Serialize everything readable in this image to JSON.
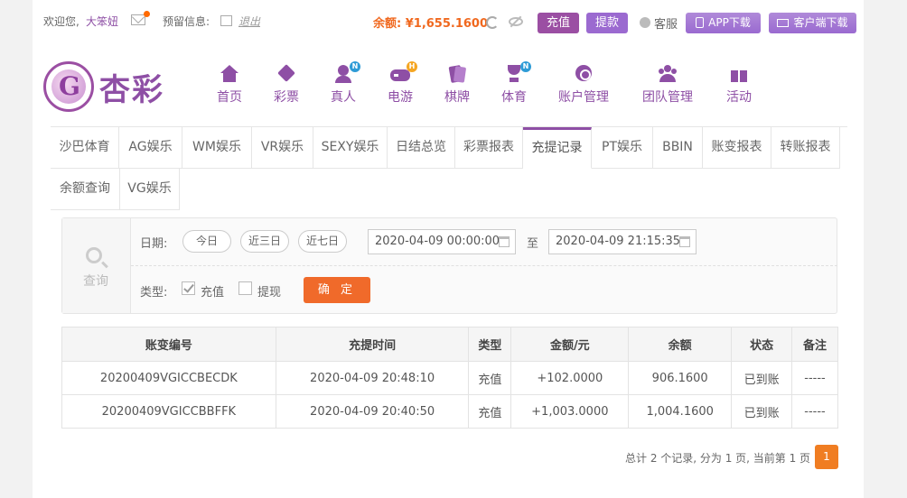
{
  "header": {
    "welcome": "欢迎您,",
    "username": "大笨妞",
    "reserved_info": "预留信息:",
    "logout": "退出",
    "balance": "余额: ¥1,655.1600",
    "recharge": "充值",
    "withdraw": "提款",
    "service": "客服",
    "app_download": "APP下载",
    "client_download": "客户端下载"
  },
  "brand": {
    "logo_text": "杏彩"
  },
  "nav": [
    {
      "label": "首页",
      "icon": "home-icon"
    },
    {
      "label": "彩票",
      "icon": "ticket-icon"
    },
    {
      "label": "真人",
      "icon": "person-icon",
      "badge": "N"
    },
    {
      "label": "电游",
      "icon": "gamepad-icon",
      "badge": "H"
    },
    {
      "label": "棋牌",
      "icon": "cards-icon"
    },
    {
      "label": "体育",
      "icon": "trophy-icon",
      "badge": "N"
    },
    {
      "label": "账户管理",
      "icon": "coin-icon"
    },
    {
      "label": "团队管理",
      "icon": "team-icon"
    },
    {
      "label": "活动",
      "icon": "gift-icon"
    }
  ],
  "tabs": [
    "沙巴体育",
    "AG娱乐",
    "WM娱乐",
    "VR娱乐",
    "SEXY娱乐",
    "日结总览",
    "彩票报表",
    "充提记录",
    "PT娱乐",
    "BBIN",
    "账变报表",
    "转账报表",
    "余额查询",
    "VG娱乐"
  ],
  "active_tab": "充提记录",
  "search": {
    "side_label": "查询",
    "date_label": "日期:",
    "quick": [
      "今日",
      "近三日",
      "近七日"
    ],
    "start": "2020-04-09 00:00:00",
    "to": "至",
    "end": "2020-04-09 21:15:35",
    "type_label": "类型:",
    "type_recharge": "充值",
    "type_withdraw": "提现",
    "recharge_checked": true,
    "withdraw_checked": false,
    "confirm": "确 定"
  },
  "table": {
    "headers": [
      "账变编号",
      "充提时间",
      "类型",
      "金额/元",
      "余额",
      "状态",
      "备注"
    ],
    "rows": [
      [
        "20200409VGICCBECDK",
        "2020-04-09 20:48:10",
        "充值",
        "+102.0000",
        "906.1600",
        "已到账",
        "-----"
      ],
      [
        "20200409VGICCBBFFK",
        "2020-04-09 20:40:50",
        "充值",
        "+1,003.0000",
        "1,004.1600",
        "已到账",
        "-----"
      ]
    ]
  },
  "pager": {
    "summary": "总计 2 个记录, 分为 1 页, 当前第 1 页",
    "current": "1"
  }
}
